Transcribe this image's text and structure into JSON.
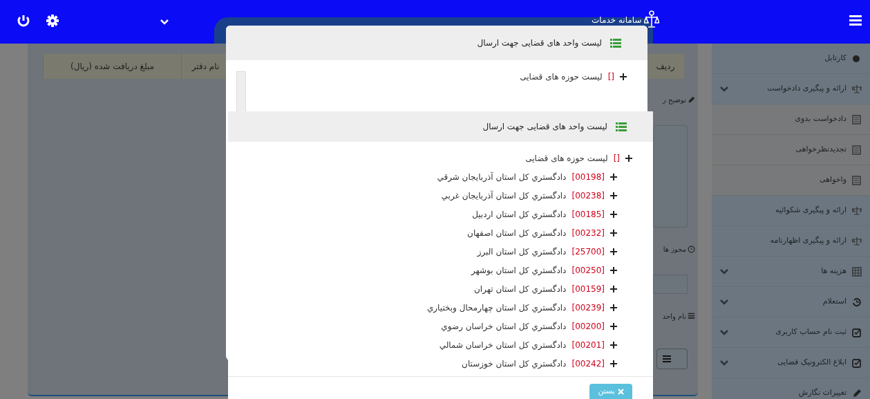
{
  "top_bar": {
    "title": "سامانه خدمات"
  },
  "sidebar": {
    "items": [
      {
        "label": "کارتابل",
        "expandable": false
      },
      {
        "label": "ارائه و پیگیری دادخواست",
        "expandable": true,
        "children": [
          {
            "label": "دادخواست بدوی"
          },
          {
            "label": "تجدیدنظرخواهی"
          },
          {
            "label": "واخواهی"
          }
        ]
      },
      {
        "label": "ارائه و پیگیری شکوائیه",
        "expandable": false
      },
      {
        "label": "ارائه و پیگیری اظهارنامه",
        "expandable": false
      },
      {
        "label": "هزینه ها",
        "expandable": true
      },
      {
        "label": "استعلام",
        "expandable": true
      },
      {
        "label": "ثبت نام حساب کاربری",
        "expandable": true
      },
      {
        "label": "ابلاغ الکترونیک قضایی",
        "expandable": true
      },
      {
        "label": "تغییرات نگارش",
        "expandable": false
      }
    ]
  },
  "page": {
    "table_columns": [
      "ردیف",
      "نام دفتر",
      "مبلغ دریافت شده (ریال)"
    ],
    "form_labels": [
      "توضیح ر",
      "مجوز ها",
      "نام واحد"
    ]
  },
  "dialogs": [
    {
      "title": "لیست واحد های قضایی جهت ارسال",
      "tree": {
        "code": "[]",
        "label": "لیست حوزه های قضایی"
      }
    },
    {
      "title": "لیست واحد های قضایی جهت ارسال",
      "tree": {
        "code": "[]",
        "label": "لیست حوزه های قضایی",
        "children": [
          {
            "code": "[00198]",
            "label": "دادگستري کل استان آذربايجان شرقي"
          },
          {
            "code": "[00238]",
            "label": "دادگستري کل استان آذربايجان غربي"
          },
          {
            "code": "[00185]",
            "label": "دادگستري کل استان اردبيل"
          },
          {
            "code": "[00232]",
            "label": "دادگستري کل استان اصفهان"
          },
          {
            "code": "[25700]",
            "label": "دادگستري کل استان البرز"
          },
          {
            "code": "[00250]",
            "label": "دادگستري کل استان بوشهر"
          },
          {
            "code": "[00159]",
            "label": "دادگستري کل استان تهران"
          },
          {
            "code": "[00239]",
            "label": "دادگستري کل استان چهارمحال وبختياري"
          },
          {
            "code": "[00200]",
            "label": "دادگستري کل استان خراسان رضوي"
          },
          {
            "code": "[00201]",
            "label": "دادگستري کل استان خراسان شمالي"
          },
          {
            "code": "[00242]",
            "label": "دادگستري کل استان خوزستان"
          }
        ]
      },
      "buttons": [
        "بستن"
      ]
    }
  ]
}
